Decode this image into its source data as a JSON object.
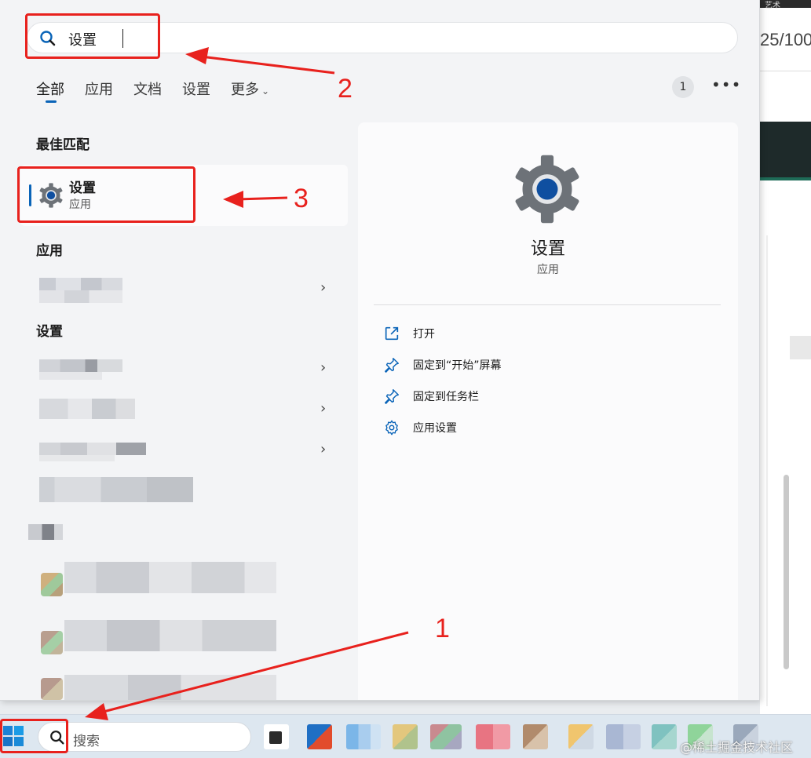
{
  "search": {
    "query": "设置"
  },
  "tabs": [
    {
      "label": "全部"
    },
    {
      "label": "应用"
    },
    {
      "label": "文档"
    },
    {
      "label": "设置"
    },
    {
      "label": "更多"
    }
  ],
  "header_badge": "1",
  "sections": {
    "best_match": "最佳匹配",
    "apps": "应用",
    "settings": "设置"
  },
  "best_match_item": {
    "name": "设置",
    "type": "应用"
  },
  "detail": {
    "title": "设置",
    "subtitle": "应用",
    "actions": [
      {
        "label": "打开",
        "icon": "open-external-icon"
      },
      {
        "label": "固定到“开始”屏幕",
        "icon": "pin-icon"
      },
      {
        "label": "固定到任务栏",
        "icon": "pin-icon"
      },
      {
        "label": "应用设置",
        "icon": "gear-icon"
      }
    ]
  },
  "taskbar": {
    "search_placeholder": "搜索"
  },
  "background_app": {
    "page_indicator": "25/100",
    "top_text": "艺术"
  },
  "annotations": [
    "1",
    "2",
    "3"
  ],
  "watermark": "@稀土掘金技术社区",
  "colors": {
    "accent": "#0a64b8",
    "annotation_red": "#e8211d",
    "panel_bg": "#f3f4f6"
  }
}
